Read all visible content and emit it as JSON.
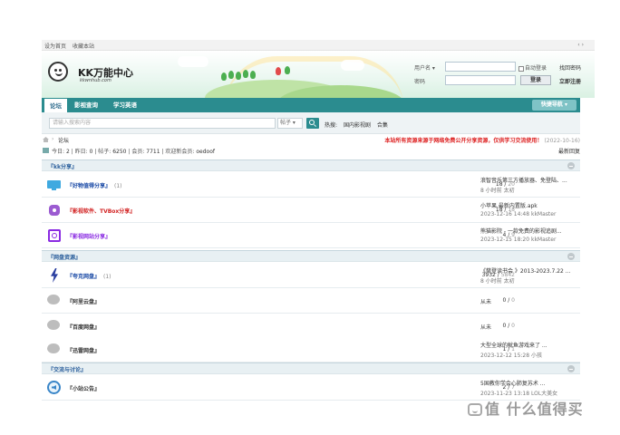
{
  "topbar": {
    "set_home": "设为首页",
    "bookmark": "收藏本站",
    "arrows": "‹ ›"
  },
  "logo": {
    "title": "KK万能中心",
    "subtitle": "kkwnhub.com"
  },
  "login": {
    "username_label": "用户名 ▾",
    "password_label": "密码",
    "auto_login": "自动登录",
    "forgot_password": "找回密码",
    "login_button": "登录",
    "register": "立即注册"
  },
  "nav": {
    "tabs": [
      "论坛",
      "影视查询",
      "学习英语"
    ],
    "quick_nav": "快捷导航 ▾"
  },
  "search": {
    "placeholder": "请输入搜索内容",
    "type": "帖子 ▾",
    "hot_label": "热搜:",
    "hot_items": [
      "国内影视剧",
      "合集"
    ]
  },
  "breadcrumb": {
    "current": "论坛",
    "separator": "›"
  },
  "notice": {
    "text": "本站所有资源来源于网络免费公开分享资源，仅供学习交流使用！",
    "date": "(2022-10-16)"
  },
  "stats": {
    "today_label": "今日:",
    "today": "2",
    "yesterday_label": "昨日:",
    "yesterday": "0",
    "posts_label": "帖子:",
    "posts": "6250",
    "members_label": "会员:",
    "members": "7711",
    "newest_label": "欢迎新会员:",
    "newest": "oedoof",
    "latest_replies": "最新回复"
  },
  "sections": [
    {
      "title": "『kk分享』",
      "forums": [
        {
          "name": "『好物值得分享』",
          "today": "(1)",
          "threads": "18",
          "posts": "20",
          "last_subject": "浪智音乐第三方播放器、免登陆、...",
          "last_meta": "8 小时前 太初",
          "color": "#1a4aa6"
        },
        {
          "name": "『影视软件、TVBox分享』",
          "today": "",
          "threads": "18",
          "posts": "18",
          "last_subject": "小苹果 最新内置版.apk",
          "last_meta": "2023-12-16 14:48 kkMaster",
          "color": "#d22222"
        },
        {
          "name": "『影视网站分享』",
          "today": "",
          "threads": "4",
          "posts": "9",
          "last_subject": "熊猫影院 - 一款免费的影视追剧...",
          "last_meta": "2023-12-15 18:20 kkMaster",
          "color": "#8a2be2"
        }
      ]
    },
    {
      "title": "『网盘资源』",
      "forums": [
        {
          "name": "『夸克网盘』",
          "today": "(1)",
          "threads": "3932",
          "posts": "5842",
          "last_subject": "《樊登读书会 》2013-2023.7.22 ...",
          "last_meta": "8 小时前 太初",
          "color": "#1a4aa6"
        },
        {
          "name": "『阿里云盘』",
          "today": "",
          "threads": "0",
          "posts": "0",
          "last_subject": "从未",
          "last_meta": "",
          "color": "#333333"
        },
        {
          "name": "『百度网盘』",
          "today": "",
          "threads": "0",
          "posts": "0",
          "last_subject": "从未",
          "last_meta": "",
          "color": "#333333"
        },
        {
          "name": "『迅雷网盘』",
          "today": "",
          "threads": "1",
          "posts": "1",
          "last_subject": "大型全球的鱿鱼游戏来了 ...",
          "last_meta": "2023-12-12 15:28 小孩",
          "color": "#333333"
        }
      ]
    },
    {
      "title": "『交流与讨论』",
      "forums": [
        {
          "name": "『小站公告』",
          "today": "",
          "threads": "2",
          "posts": "7",
          "last_subject": "5国教你学会心肺复苏术 ...",
          "last_meta": "2023-11-23 13:18 LOL大美女",
          "color": "#333333"
        }
      ]
    }
  ],
  "watermark": "值 什么值得买",
  "colors": {
    "nav": "#2b8c8f",
    "notice": "#d22222",
    "section_title": "#2b5f9c"
  }
}
